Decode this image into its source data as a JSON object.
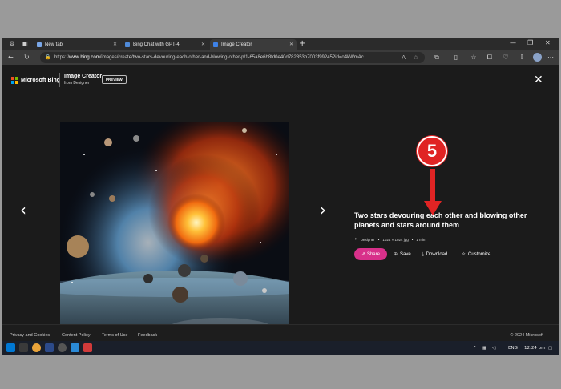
{
  "tabs": [
    {
      "label": "New tab",
      "active": false
    },
    {
      "label": "Bing Chat with GPT-4",
      "active": false
    },
    {
      "label": "Image Creator",
      "active": true
    }
  ],
  "address": {
    "scheme": "https://",
    "host": "www.bing.com",
    "path": "/images/create/two-stars-devouring-each-other-and-blowing-other-p/1-65a8e6b8fd0e40d782353b7003f99245?id=o4kWmAc..."
  },
  "header": {
    "brand": "Microsoft Bing",
    "app_title": "Image Creator",
    "app_subtitle": "from Designer",
    "badge": "PREVIEW"
  },
  "image": {
    "caption": "Two stars devouring each other and blowing other planets and stars around them",
    "author": "Designer",
    "size": "1024 × 1024 jpg",
    "time": "1 min"
  },
  "actions": {
    "share": "Share",
    "save": "Save",
    "download": "Download",
    "customize": "Customize"
  },
  "footer": {
    "links": [
      "Privacy and Cookies",
      "Content Policy",
      "Terms of Use",
      "Feedback"
    ],
    "copyright": "© 2024 Microsoft"
  },
  "annotation": {
    "step": "5",
    "color": "#e02424"
  },
  "taskbar": {
    "lang": "ENG",
    "time": "12:24 pm"
  },
  "colors": {
    "share": "#d8308a",
    "background": "#1b1b1b"
  }
}
